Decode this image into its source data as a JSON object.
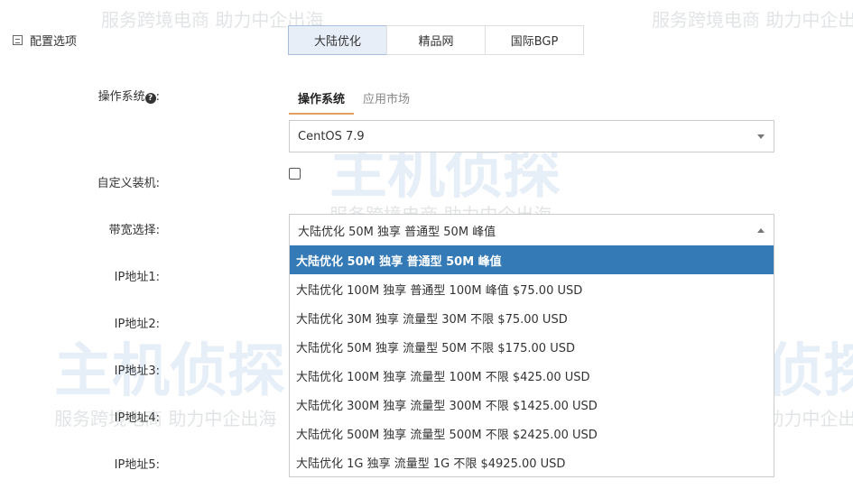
{
  "watermark": {
    "slogan": "服务跨境电商 助力中企出海",
    "logo": "主机侦探"
  },
  "section": {
    "title": "配置选项"
  },
  "region_tabs": [
    {
      "label": "大陆优化",
      "active": true
    },
    {
      "label": "精品网",
      "active": false
    },
    {
      "label": "国际BGP",
      "active": false
    }
  ],
  "labels": {
    "os": "操作系统",
    "os_suffix": ":",
    "custom": "自定义装机:",
    "bandwidth": "带宽选择:",
    "ip1": "IP地址1:",
    "ip2": "IP地址2:",
    "ip3": "IP地址3:",
    "ip4": "IP地址4:",
    "ip5": "IP地址5:"
  },
  "os_tabs": [
    {
      "label": "操作系统",
      "active": true
    },
    {
      "label": "应用市场",
      "active": false
    }
  ],
  "os_select": {
    "value": "CentOS 7.9"
  },
  "bandwidth_select": {
    "value": "大陆优化 50M 独享 普通型 50M 峰值"
  },
  "bandwidth_options": [
    "大陆优化 50M 独享 普通型 50M 峰值",
    "大陆优化 100M 独享 普通型 100M 峰值 $75.00 USD",
    "大陆优化 30M 独享 流量型 30M 不限 $75.00 USD",
    "大陆优化 50M 独享 流量型 50M 不限 $175.00 USD",
    "大陆优化 100M 独享 流量型 100M 不限 $425.00 USD",
    "大陆优化 300M 独享 流量型 300M 不限 $1425.00 USD",
    "大陆优化 500M 独享 流量型 500M 不限 $2425.00 USD",
    "大陆优化 1G 独享 流量型 1G 不限 $4925.00 USD"
  ],
  "colors": {
    "highlight": "#337ab7",
    "tab_active": "#e8eef8"
  }
}
